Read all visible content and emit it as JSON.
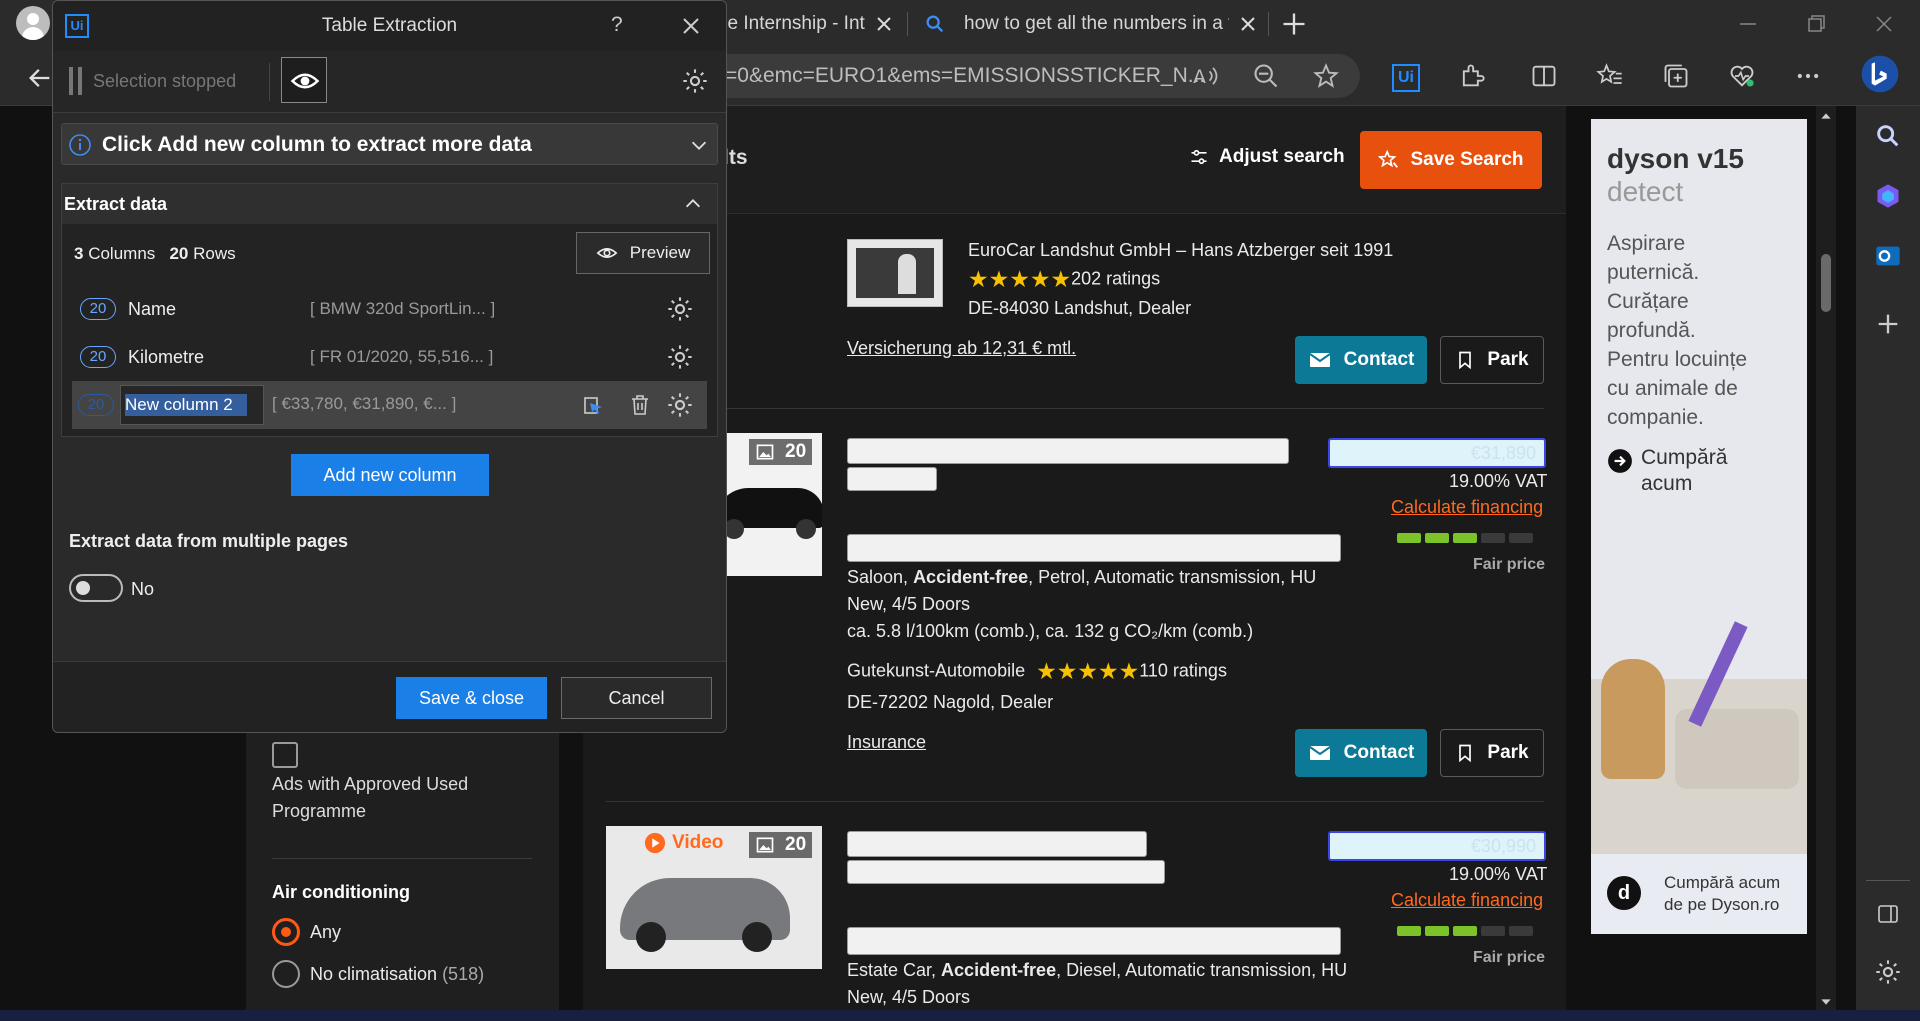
{
  "browser": {
    "tabs": [
      {
        "label": "ce Internship - Int"
      },
      {
        "label": "how to get all the numbers in a t"
      }
    ],
    "address": "=0&emc=EURO1&ems=EMISSIONSSTICKER_N...",
    "ext_label": "Ui"
  },
  "dialog": {
    "app_icon": "Ui",
    "title": "Table Extraction",
    "help": "?",
    "selection_status": "Selection stopped",
    "info_banner": "Click Add new column to extract more data",
    "section_title": "Extract data",
    "columns_count": "3",
    "columns_label": "Columns",
    "rows_count": "20",
    "rows_label": "Rows",
    "preview_label": "Preview",
    "columns": [
      {
        "badge": "20",
        "name": "Name",
        "sample": "[ BMW 320d SportLin... ]"
      },
      {
        "badge": "20",
        "name": "Kilometre",
        "sample": "[ FR 01/2020, 55,516...  ]"
      },
      {
        "badge": "20",
        "name": "New column 2",
        "sample": "[ €33,780, €31,890, €...  ]"
      }
    ],
    "add_column_label": "Add new column",
    "multipage_label": "Extract data from multiple pages",
    "toggle_value": "No",
    "save_label": "Save & close",
    "cancel_label": "Cancel"
  },
  "filters": {
    "approved_label_1": "Ads with Approved Used",
    "approved_label_2": "Programme",
    "ac_title": "Air conditioning",
    "ac_options": [
      {
        "label": "Any",
        "count": ""
      },
      {
        "label": "No climatisation",
        "count": "(518)"
      }
    ]
  },
  "header": {
    "title_fragment": "lts",
    "adjust_label": "Adjust search",
    "save_search_label": "Save Search"
  },
  "listings": [
    {
      "dealer": "EuroCar Landshut GmbH – Hans Atzberger seit 1991",
      "ratings": "202 ratings",
      "location": "DE-84030 Landshut, Dealer",
      "link": "Versicherung ab 12,31 € mtl.",
      "contact": "Contact",
      "park": "Park"
    },
    {
      "photos": "20",
      "price_blur": "€31,890",
      "vat": "19.00% VAT",
      "financing": "Calculate financing",
      "price_rating": "Fair price",
      "price_bars": 3,
      "desc_1_pre": "Saloon, ",
      "desc_1_bold": "Accident-free",
      "desc_1_post": ", Petrol, Automatic transmission, HU",
      "desc_2": "New, 4/5 Doors",
      "desc_3": "ca. 5.8 l/100km (comb.), ca. 132 g CO₂/km (comb.)",
      "dealer": "Gutekunst-Automobile",
      "ratings": "110 ratings",
      "location": "DE-72202 Nagold, Dealer",
      "link": "Insurance",
      "contact": "Contact",
      "park": "Park"
    },
    {
      "photos": "20",
      "video": "Video",
      "price_blur": "€30,990",
      "vat": "19.00% VAT",
      "financing": "Calculate financing",
      "price_rating": "Fair price",
      "price_bars": 3,
      "desc_1_pre": "Estate Car, ",
      "desc_1_bold": "Accident-free",
      "desc_1_post": ", Diesel, Automatic transmission, HU",
      "desc_2": "New, 4/5 Doors"
    }
  ],
  "ad": {
    "brand": "dyson v15",
    "subbrand": "detect",
    "copy": [
      "Aspirare",
      "puternică.",
      "Curățare",
      "profundă.",
      "Pentru locuințe",
      "cu animale de",
      "companie."
    ],
    "cta_1": "Cumpără",
    "cta_2": "acum",
    "footer_1": "Cumpără acum",
    "footer_2": "de pe Dyson.ro",
    "footer_logo": "d"
  },
  "colors": {
    "accent_orange": "#e8500e",
    "contact_teal": "#0c7a96",
    "uipath_blue": "#1a7fe6"
  }
}
